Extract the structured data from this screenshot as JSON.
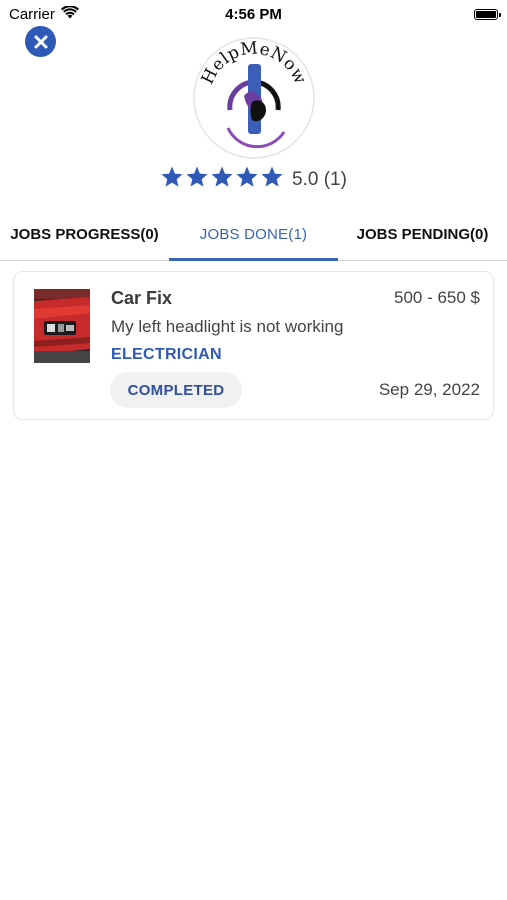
{
  "status_bar": {
    "carrier": "Carrier",
    "time": "4:56 PM"
  },
  "header": {
    "logo_text": "HelpMeNow",
    "rating": {
      "stars": 5,
      "text": "5.0 (1)"
    }
  },
  "tabs": [
    {
      "label": "JOBS PROGRESS(0)",
      "active": false
    },
    {
      "label": "JOBS DONE(1)",
      "active": true
    },
    {
      "label": "JOBS PENDING(0)",
      "active": false
    }
  ],
  "jobs": [
    {
      "title": "Car Fix",
      "price": "500 - 650 $",
      "description": "My left headlight is not working",
      "category": "ELECTRICIAN",
      "status": "COMPLETED",
      "date": "Sep 29, 2022"
    }
  ],
  "colors": {
    "accent": "#2f59b6",
    "tab_active": "#3b63b5",
    "star": "#2f59b6",
    "logo_purple": "#6a3ea1"
  }
}
